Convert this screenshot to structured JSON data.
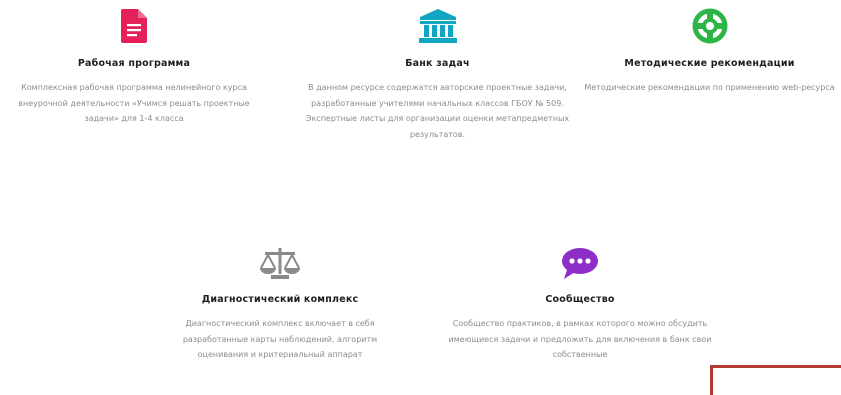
{
  "cards": [
    {
      "title": "Рабочая программа",
      "desc": "Комплексная рабочая программа нелинейного курса внеурочной деятельности «Учимся решать проектные задачи» для 1-4 класса",
      "icon": "document-icon",
      "color": "#e5215c"
    },
    {
      "title": "Банк задач",
      "desc": "В данном ресурсе содержатся авторские проектные задачи, разработанные учителями начальных классов ГБОУ № 509. Экспертные листы для организации оценки метапредметных результатов.",
      "icon": "bank-icon",
      "color": "#10a6c1"
    },
    {
      "title": "Методические рекомендации",
      "desc": "Методические рекомендации по применению web-ресурса",
      "icon": "lifebuoy-icon",
      "color": "#2eb548"
    },
    {
      "title": "Диагностический комплекс",
      "desc": "Диагностический комплекс включает в себя разработанные карты наблюдений, алгоритм оценивания и критериальный аппарат",
      "icon": "scales-icon",
      "color": "#8a8a8a"
    },
    {
      "title": "Сообщество",
      "desc": "Сообщество практиков, в рамках которого можно обсудить имеющиеся задачи и предложить для включения в банк свои собственные",
      "icon": "chat-bubble-icon",
      "color": "#8e2ec8"
    }
  ]
}
